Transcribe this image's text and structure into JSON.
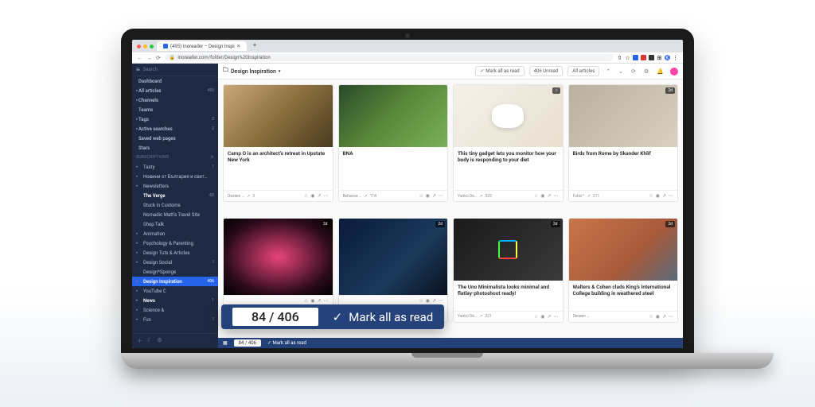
{
  "browser": {
    "tab_title": "(495) Inoreader – Design Inspi",
    "url": "inoreader.com/folder/Design%20Inspiration"
  },
  "sidebar": {
    "search_placeholder": "Search",
    "items": [
      {
        "label": "Dashboard",
        "count": ""
      },
      {
        "label": "All articles",
        "count": "495"
      },
      {
        "label": "Channels",
        "count": ""
      },
      {
        "label": "Teams",
        "count": ""
      },
      {
        "label": "Tags",
        "count": "2"
      },
      {
        "label": "Active searches",
        "count": "2"
      },
      {
        "label": "Saved web pages",
        "count": ""
      },
      {
        "label": "Stars",
        "count": ""
      }
    ],
    "section_label": "SUBSCRIPTIONS",
    "subs": [
      {
        "label": "Tasty",
        "count": "1"
      },
      {
        "label": "Новини от България и свет…",
        "count": ""
      },
      {
        "label": "Newsletters",
        "count": ""
      },
      {
        "label": "The Verge",
        "count": "65"
      },
      {
        "label": "Stuck in Customs",
        "count": ""
      },
      {
        "label": "Nomadic Matt's Travel Site",
        "count": ""
      },
      {
        "label": "Shop Talk",
        "count": ""
      },
      {
        "label": "Animation",
        "count": ""
      },
      {
        "label": "Psychology & Parenting",
        "count": ""
      },
      {
        "label": "Design Tuts & Articles",
        "count": ""
      },
      {
        "label": "Design Social",
        "count": "3"
      },
      {
        "label": "Design*Sponge",
        "count": ""
      },
      {
        "label": "Design Inspiration",
        "count": "406"
      },
      {
        "label": "YouTube C",
        "count": ""
      },
      {
        "label": "News",
        "count": "1"
      },
      {
        "label": "Science &",
        "count": ""
      },
      {
        "label": "Fun",
        "count": "3"
      }
    ]
  },
  "toolbar": {
    "folder_title": "Design Inspiration",
    "mark_read": "Mark all as read",
    "unread": "406 Unread",
    "filter": "All articles"
  },
  "cards": [
    {
      "title": "Camp O is an architect's retreat in Upstate New York",
      "src": "Dezeen …",
      "views": "3",
      "badge": ""
    },
    {
      "title": "BNA",
      "src": "Behance …",
      "views": "114",
      "badge": ""
    },
    {
      "title": "This tiny gadget lets you monitor how your body is responding to your diet",
      "src": "Yanko De…",
      "views": "325",
      "badge": "○"
    },
    {
      "title": "Birds from Rome by Skander Khlif",
      "src": "Fubiz™",
      "views": "211",
      "badge": "2d"
    },
    {
      "title": "",
      "src": "",
      "views": "",
      "badge": "2d"
    },
    {
      "title": "",
      "src": "",
      "views": "",
      "badge": "2d"
    },
    {
      "title": "The Uno Minimalista looks minimal and flatlay-photoshoot ready!",
      "src": "Yanko De…",
      "views": "321",
      "badge": "2d"
    },
    {
      "title": "Walters & Cohen clads King's International College building in weathered steel",
      "src": "Dezeen …",
      "views": "",
      "badge": "2d"
    }
  ],
  "footer": {
    "counter": "84 / 406",
    "mark": "Mark all as read"
  },
  "magnify": {
    "counter": "84 / 406",
    "mark": "Mark all as read"
  }
}
